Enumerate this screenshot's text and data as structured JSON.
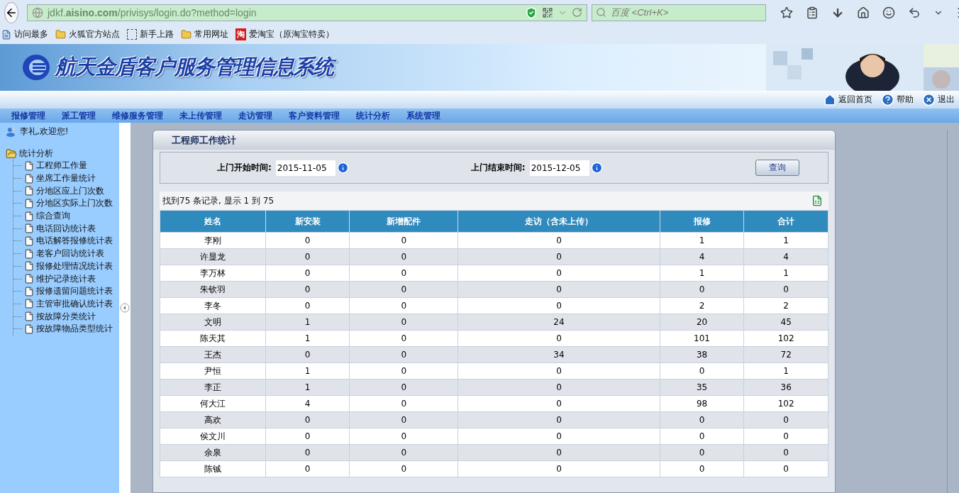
{
  "browser": {
    "url": "jdkf.**aisino.com**/privisys/login.do?method=login",
    "search_placeholder": "百度 <Ctrl+K>",
    "bookmarks": [
      {
        "kind": "page",
        "label": "访问最多"
      },
      {
        "kind": "folder",
        "label": "火狐官方站点"
      },
      {
        "kind": "blank",
        "label": "新手上路"
      },
      {
        "kind": "folder",
        "label": "常用网址"
      },
      {
        "kind": "badge",
        "badge_text": "淘",
        "label": "爱淘宝（原淘宝特卖）"
      }
    ]
  },
  "header": {
    "title": "航天金盾客户服务管理信息系统",
    "links": [
      {
        "kind": "home",
        "label": "返回首页"
      },
      {
        "kind": "help",
        "label": "帮助"
      },
      {
        "kind": "exit",
        "label": "退出"
      }
    ]
  },
  "nav": [
    "报修管理",
    "派工管理",
    "维修服务管理",
    "未上传管理",
    "走访管理",
    "客户资料管理",
    "统计分析",
    "系统管理"
  ],
  "sidebar": {
    "greeting": "李礼,欢迎您!",
    "group": {
      "label": "统计分析",
      "expanded": true,
      "children": [
        "工程师工作量",
        "坐席工作量统计",
        "分地区应上门次数",
        "分地区实际上门次数",
        "综合查询",
        "电话回访统计表",
        "电话解答报修统计表",
        "老客户回访统计表",
        "报修处理情况统计表",
        "维护记录统计表",
        "报修遗留问题统计表",
        "主管审批确认统计表",
        "按故障分类统计",
        "按故障物品类型统计"
      ]
    }
  },
  "panel": {
    "title": "工程师工作统计",
    "filters": [
      {
        "label": "上门开始时间:",
        "value": "2015-11-05"
      },
      {
        "label": "上门结束时间:",
        "value": "2015-12-05"
      }
    ],
    "button": "查询",
    "summary": "找到75 条记录, 显示 1 到 75",
    "columns": [
      "姓名",
      "新安装",
      "新增配件",
      "走访（含未上传）",
      "报修",
      "合计"
    ],
    "rows": [
      [
        "李刚",
        "0",
        "0",
        "0",
        "1",
        "1"
      ],
      [
        "许显龙",
        "0",
        "0",
        "0",
        "4",
        "4"
      ],
      [
        "李万林",
        "0",
        "0",
        "0",
        "1",
        "1"
      ],
      [
        "朱钦羽",
        "0",
        "0",
        "0",
        "0",
        "0"
      ],
      [
        "李冬",
        "0",
        "0",
        "0",
        "2",
        "2"
      ],
      [
        "文明",
        "1",
        "0",
        "24",
        "20",
        "45"
      ],
      [
        "陈天其",
        "1",
        "0",
        "0",
        "101",
        "102"
      ],
      [
        "王杰",
        "0",
        "0",
        "34",
        "38",
        "72"
      ],
      [
        "尹恒",
        "1",
        "0",
        "0",
        "0",
        "1"
      ],
      [
        "李正",
        "1",
        "0",
        "0",
        "35",
        "36"
      ],
      [
        "何大江",
        "4",
        "0",
        "0",
        "98",
        "102"
      ],
      [
        "高欢",
        "0",
        "0",
        "0",
        "0",
        "0"
      ],
      [
        "侯文川",
        "0",
        "0",
        "0",
        "0",
        "0"
      ],
      [
        "余泉",
        "0",
        "0",
        "0",
        "0",
        "0"
      ],
      [
        "陈铖",
        "0",
        "0",
        "0",
        "0",
        "0"
      ]
    ]
  }
}
